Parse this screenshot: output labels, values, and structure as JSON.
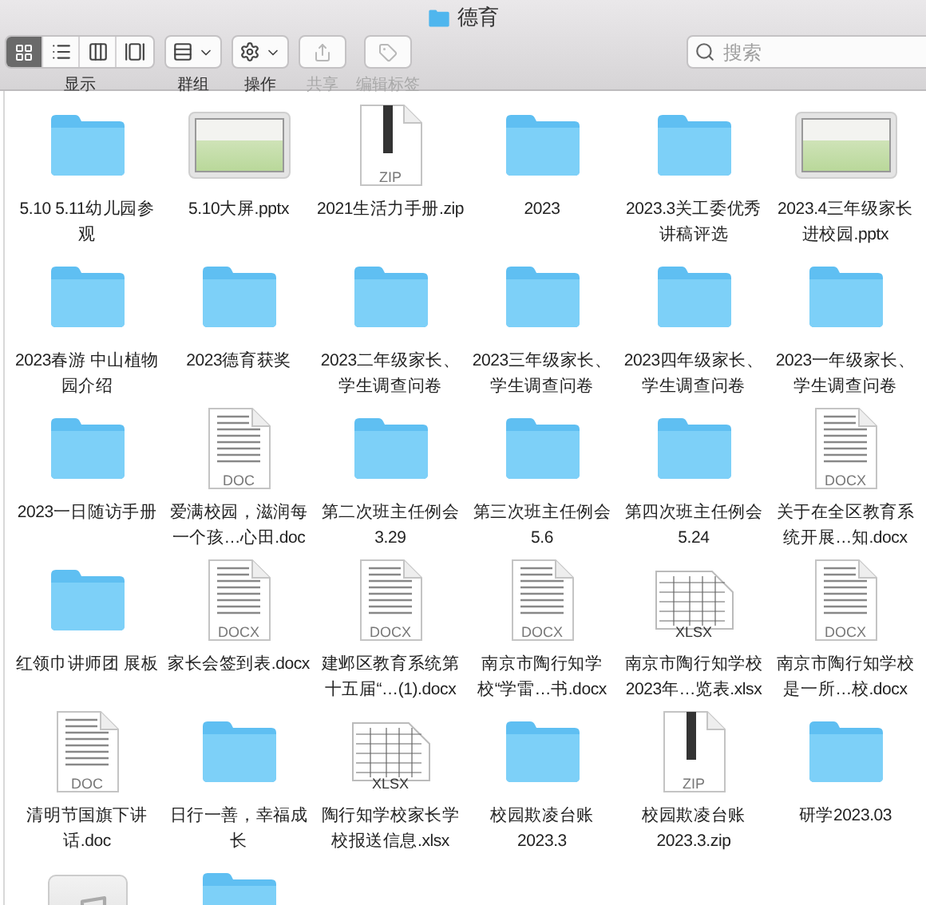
{
  "window": {
    "title": "德育"
  },
  "toolbar": {
    "groups": [
      {
        "kind": "view",
        "label": "显示",
        "disabled": false,
        "modes": [
          {
            "kind": "icons",
            "selected": true
          },
          {
            "kind": "list",
            "selected": false
          },
          {
            "kind": "columns",
            "selected": false
          },
          {
            "kind": "gallery",
            "selected": false
          }
        ]
      },
      {
        "kind": "group",
        "label": "群组",
        "disabled": false
      },
      {
        "kind": "action",
        "label": "操作",
        "disabled": false
      },
      {
        "kind": "share",
        "label": "共享",
        "disabled": true
      },
      {
        "kind": "tags",
        "label": "编辑标签",
        "disabled": true
      }
    ],
    "search": {
      "placeholder": "搜索"
    }
  },
  "items": [
    {
      "kind": "folder",
      "name": "5.10 5.11幼儿园参观"
    },
    {
      "kind": "slides",
      "name": "5.10大屏.pptx"
    },
    {
      "kind": "zip",
      "name": "2021生活力手册.zip",
      "badge": "ZIP"
    },
    {
      "kind": "folder",
      "name": "2023"
    },
    {
      "kind": "folder",
      "name": "2023.3关工委优秀讲稿评选"
    },
    {
      "kind": "slides",
      "name": "2023.4三年级家长进校园.pptx"
    },
    {
      "kind": "folder",
      "name": "2023春游 中山植物园介绍"
    },
    {
      "kind": "folder",
      "name": "2023德育获奖"
    },
    {
      "kind": "folder",
      "name": "2023二年级家长、学生调查问卷"
    },
    {
      "kind": "folder",
      "name": "2023三年级家长、学生调查问卷"
    },
    {
      "kind": "folder",
      "name": "2023四年级家长、学生调查问卷"
    },
    {
      "kind": "folder",
      "name": "2023一年级家长、学生调查问卷"
    },
    {
      "kind": "folder",
      "name": "2023一日随访手册"
    },
    {
      "kind": "document",
      "name": "爱满校园，滋润每一个孩…心田.doc",
      "badge": "DOC"
    },
    {
      "kind": "folder",
      "name": "第二次班主任例会3.29"
    },
    {
      "kind": "folder",
      "name": "第三次班主任例会5.6"
    },
    {
      "kind": "folder",
      "name": "第四次班主任例会5.24"
    },
    {
      "kind": "document",
      "name": "关于在全区教育系统开展…知.docx",
      "badge": "DOCX"
    },
    {
      "kind": "folder",
      "name": "红领巾讲师团 展板"
    },
    {
      "kind": "document",
      "name": "家长会签到表.docx",
      "badge": "DOCX"
    },
    {
      "kind": "document",
      "name": "建邺区教育系统第十五届“…(1).docx",
      "badge": "DOCX"
    },
    {
      "kind": "document",
      "name": "南京市陶行知学校“学雷…书.docx",
      "badge": "DOCX"
    },
    {
      "kind": "sheet",
      "name": "南京市陶行知学校2023年…览表.xlsx",
      "badge": "XLSX"
    },
    {
      "kind": "document",
      "name": "南京市陶行知学校是一所…校.docx",
      "badge": "DOCX"
    },
    {
      "kind": "document",
      "name": "清明节国旗下讲话.doc",
      "badge": "DOC"
    },
    {
      "kind": "folder",
      "name": "日行一善，幸福成长"
    },
    {
      "kind": "sheet",
      "name": "陶行知学校家长学校报送信息.xlsx",
      "badge": "XLSX"
    },
    {
      "kind": "folder",
      "name": "校园欺凌台账2023.3"
    },
    {
      "kind": "zip",
      "name": "校园欺凌台账2023.3.zip",
      "badge": "ZIP"
    },
    {
      "kind": "folder",
      "name": "研学2023.03"
    },
    {
      "kind": "audio"
    },
    {
      "kind": "folder"
    }
  ]
}
